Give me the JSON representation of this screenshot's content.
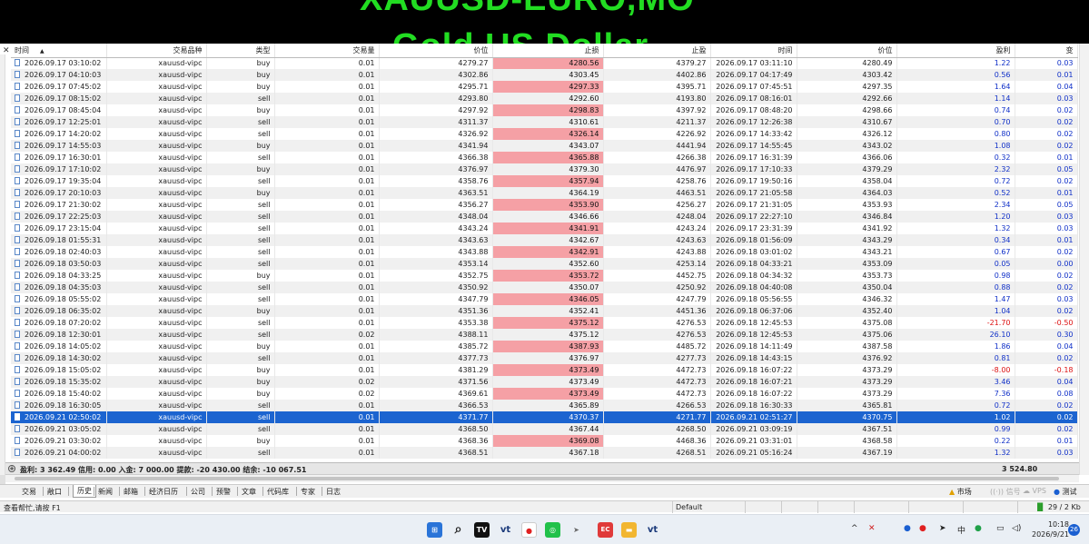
{
  "banner": {
    "line1": "XAUUSD-EURO,MO",
    "line2": "Gold US Dollar"
  },
  "table": {
    "columns": [
      "时间",
      "交易品种",
      "类型",
      "交易量",
      "价位",
      "止损",
      "止盈",
      "时间",
      "价位",
      "盈利",
      "变"
    ],
    "sort_indicator": "▲",
    "rows": [
      [
        "2026.09.17 03:10:02",
        "xauusd-vipc",
        "buy",
        "0.01",
        "4279.27",
        "4280.56",
        "4379.27",
        "2026.09.17 03:11:10",
        "4280.49",
        "1.22",
        "0.03"
      ],
      [
        "2026.09.17 04:10:03",
        "xauusd-vipc",
        "buy",
        "0.01",
        "4302.86",
        "4303.45",
        "4402.86",
        "2026.09.17 04:17:49",
        "4303.42",
        "0.56",
        "0.01"
      ],
      [
        "2026.09.17 07:45:02",
        "xauusd-vipc",
        "buy",
        "0.01",
        "4295.71",
        "4297.33",
        "4395.71",
        "2026.09.17 07:45:51",
        "4297.35",
        "1.64",
        "0.04"
      ],
      [
        "2026.09.17 08:15:02",
        "xauusd-vipc",
        "sell",
        "0.01",
        "4293.80",
        "4292.60",
        "4193.80",
        "2026.09.17 08:16:01",
        "4292.66",
        "1.14",
        "0.03"
      ],
      [
        "2026.09.17 08:45:04",
        "xauusd-vipc",
        "buy",
        "0.01",
        "4297.92",
        "4298.83",
        "4397.92",
        "2026.09.17 08:48:20",
        "4298.66",
        "0.74",
        "0.02"
      ],
      [
        "2026.09.17 12:25:01",
        "xauusd-vipc",
        "sell",
        "0.01",
        "4311.37",
        "4310.61",
        "4211.37",
        "2026.09.17 12:26:38",
        "4310.67",
        "0.70",
        "0.02"
      ],
      [
        "2026.09.17 14:20:02",
        "xauusd-vipc",
        "sell",
        "0.01",
        "4326.92",
        "4326.14",
        "4226.92",
        "2026.09.17 14:33:42",
        "4326.12",
        "0.80",
        "0.02"
      ],
      [
        "2026.09.17 14:55:03",
        "xauusd-vipc",
        "buy",
        "0.01",
        "4341.94",
        "4343.07",
        "4441.94",
        "2026.09.17 14:55:45",
        "4343.02",
        "1.08",
        "0.02"
      ],
      [
        "2026.09.17 16:30:01",
        "xauusd-vipc",
        "sell",
        "0.01",
        "4366.38",
        "4365.88",
        "4266.38",
        "2026.09.17 16:31:39",
        "4366.06",
        "0.32",
        "0.01"
      ],
      [
        "2026.09.17 17:10:02",
        "xauusd-vipc",
        "buy",
        "0.01",
        "4376.97",
        "4379.30",
        "4476.97",
        "2026.09.17 17:10:33",
        "4379.29",
        "2.32",
        "0.05"
      ],
      [
        "2026.09.17 19:35:04",
        "xauusd-vipc",
        "sell",
        "0.01",
        "4358.76",
        "4357.94",
        "4258.76",
        "2026.09.17 19:50:16",
        "4358.04",
        "0.72",
        "0.02"
      ],
      [
        "2026.09.17 20:10:03",
        "xauusd-vipc",
        "buy",
        "0.01",
        "4363.51",
        "4364.19",
        "4463.51",
        "2026.09.17 21:05:58",
        "4364.03",
        "0.52",
        "0.01"
      ],
      [
        "2026.09.17 21:30:02",
        "xauusd-vipc",
        "sell",
        "0.01",
        "4356.27",
        "4353.90",
        "4256.27",
        "2026.09.17 21:31:05",
        "4353.93",
        "2.34",
        "0.05"
      ],
      [
        "2026.09.17 22:25:03",
        "xauusd-vipc",
        "sell",
        "0.01",
        "4348.04",
        "4346.66",
        "4248.04",
        "2026.09.17 22:27:10",
        "4346.84",
        "1.20",
        "0.03"
      ],
      [
        "2026.09.17 23:15:04",
        "xauusd-vipc",
        "sell",
        "0.01",
        "4343.24",
        "4341.91",
        "4243.24",
        "2026.09.17 23:31:39",
        "4341.92",
        "1.32",
        "0.03"
      ],
      [
        "2026.09.18 01:55:31",
        "xauusd-vipc",
        "sell",
        "0.01",
        "4343.63",
        "4342.67",
        "4243.63",
        "2026.09.18 01:56:09",
        "4343.29",
        "0.34",
        "0.01"
      ],
      [
        "2026.09.18 02:40:03",
        "xauusd-vipc",
        "sell",
        "0.01",
        "4343.88",
        "4342.91",
        "4243.88",
        "2026.09.18 03:01:02",
        "4343.21",
        "0.67",
        "0.02"
      ],
      [
        "2026.09.18 03:50:03",
        "xauusd-vipc",
        "sell",
        "0.01",
        "4353.14",
        "4352.60",
        "4253.14",
        "2026.09.18 04:33:21",
        "4353.09",
        "0.05",
        "0.00"
      ],
      [
        "2026.09.18 04:33:25",
        "xauusd-vipc",
        "buy",
        "0.01",
        "4352.75",
        "4353.72",
        "4452.75",
        "2026.09.18 04:34:32",
        "4353.73",
        "0.98",
        "0.02"
      ],
      [
        "2026.09.18 04:35:03",
        "xauusd-vipc",
        "sell",
        "0.01",
        "4350.92",
        "4350.07",
        "4250.92",
        "2026.09.18 04:40:08",
        "4350.04",
        "0.88",
        "0.02"
      ],
      [
        "2026.09.18 05:55:02",
        "xauusd-vipc",
        "sell",
        "0.01",
        "4347.79",
        "4346.05",
        "4247.79",
        "2026.09.18 05:56:55",
        "4346.32",
        "1.47",
        "0.03"
      ],
      [
        "2026.09.18 06:35:02",
        "xauusd-vipc",
        "buy",
        "0.01",
        "4351.36",
        "4352.41",
        "4451.36",
        "2026.09.18 06:37:06",
        "4352.40",
        "1.04",
        "0.02"
      ],
      [
        "2026.09.18 07:20:02",
        "xauusd-vipc",
        "sell",
        "0.01",
        "4353.38",
        "4375.12",
        "4276.53",
        "2026.09.18 12:45:53",
        "4375.08",
        "-21.70",
        "-0.50"
      ],
      [
        "2026.09.18 12:30:01",
        "xauusd-vipc",
        "sell",
        "0.02",
        "4388.11",
        "4375.12",
        "4276.53",
        "2026.09.18 12:45:53",
        "4375.06",
        "26.10",
        "0.30"
      ],
      [
        "2026.09.18 14:05:02",
        "xauusd-vipc",
        "buy",
        "0.01",
        "4385.72",
        "4387.93",
        "4485.72",
        "2026.09.18 14:11:49",
        "4387.58",
        "1.86",
        "0.04"
      ],
      [
        "2026.09.18 14:30:02",
        "xauusd-vipc",
        "sell",
        "0.01",
        "4377.73",
        "4376.97",
        "4277.73",
        "2026.09.18 14:43:15",
        "4376.92",
        "0.81",
        "0.02"
      ],
      [
        "2026.09.18 15:05:02",
        "xauusd-vipc",
        "buy",
        "0.01",
        "4381.29",
        "4373.49",
        "4472.73",
        "2026.09.18 16:07:22",
        "4373.29",
        "-8.00",
        "-0.18"
      ],
      [
        "2026.09.18 15:35:02",
        "xauusd-vipc",
        "buy",
        "0.02",
        "4371.56",
        "4373.49",
        "4472.73",
        "2026.09.18 16:07:21",
        "4373.29",
        "3.46",
        "0.04"
      ],
      [
        "2026.09.18 15:40:02",
        "xauusd-vipc",
        "buy",
        "0.02",
        "4369.61",
        "4373.49",
        "4472.73",
        "2026.09.18 16:07:22",
        "4373.29",
        "7.36",
        "0.08"
      ],
      [
        "2026.09.18 16:30:05",
        "xauusd-vipc",
        "sell",
        "0.01",
        "4366.53",
        "4365.89",
        "4266.53",
        "2026.09.18 16:30:33",
        "4365.81",
        "0.72",
        "0.02"
      ],
      [
        "2026.09.21 02:50:02",
        "xauusd-vipc",
        "sell",
        "0.01",
        "4371.77",
        "4370.37",
        "4271.77",
        "2026.09.21 02:51:27",
        "4370.75",
        "1.02",
        "0.02"
      ],
      [
        "2026.09.21 03:05:02",
        "xauusd-vipc",
        "sell",
        "0.01",
        "4368.50",
        "4367.44",
        "4268.50",
        "2026.09.21 03:09:19",
        "4367.51",
        "0.99",
        "0.02"
      ],
      [
        "2026.09.21 03:30:02",
        "xauusd-vipc",
        "buy",
        "0.01",
        "4368.36",
        "4369.08",
        "4468.36",
        "2026.09.21 03:31:01",
        "4368.58",
        "0.22",
        "0.01"
      ],
      [
        "2026.09.21 04:00:02",
        "xauusd-vipc",
        "sell",
        "0.01",
        "4368.51",
        "4367.18",
        "4268.51",
        "2026.09.21 05:16:24",
        "4367.19",
        "1.32",
        "0.03"
      ]
    ],
    "selected_row": 30
  },
  "summary": {
    "text": "盈利: 3 362.49  信用: 0.00  入金: 7 000.00  提款: -20 430.00  结余: -10 067.51",
    "profit": "3 524.80"
  },
  "tabs": [
    "交易",
    "敞口",
    "历史",
    "新闻",
    "邮箱",
    "经济日历",
    "公司",
    "预警",
    "文章",
    "代码库",
    "专家",
    "日志"
  ],
  "active_tab": "历史",
  "tabs_right": {
    "market": "市场",
    "signals": "信号",
    "vps": "VPS",
    "tester": "测试"
  },
  "status": {
    "help": "查看帮忙,请按 F1",
    "profile": "Default",
    "traffic": "29 / 2 Kb"
  },
  "taskbar": {
    "lang": "中",
    "time": "10:18",
    "date": "2026/9/21",
    "notif": "26"
  },
  "colors": {
    "stoploss_bg": "#f5a0a5",
    "selected_bg": "#1c64d0",
    "positive": "#1030c8",
    "negative": "#dd1111",
    "banner": "#22dd22"
  }
}
